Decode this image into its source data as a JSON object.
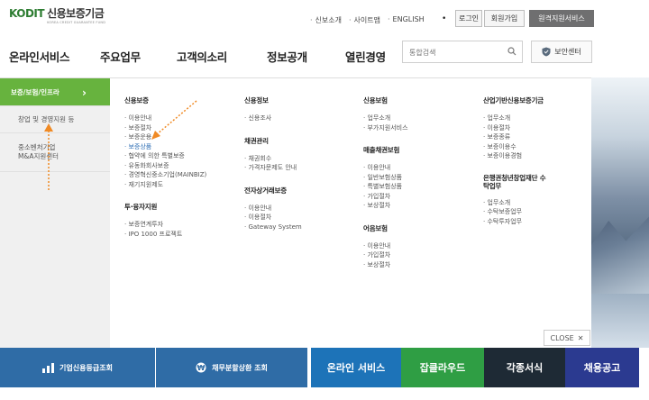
{
  "logo": {
    "mark": "KODIT",
    "title": "신용보증기금",
    "subtitle": "KOREA CREDIT GUARANTEE FUND"
  },
  "top_links": [
    "신보소개",
    "사이트맵",
    "ENGLISH"
  ],
  "top_buttons": {
    "login": "로그인",
    "join": "회원가입",
    "special": "원격지원서비스"
  },
  "gnb": [
    "온라인서비스",
    "주요업무",
    "고객의소리",
    "정보공개",
    "열린경영"
  ],
  "search": {
    "placeholder": "통합검색"
  },
  "security_center": "보안센터",
  "side_menu": {
    "active": "보증/보험/인프라",
    "items": [
      "창업 및 경영지원 등",
      "중소벤처기업 M&A지원센터"
    ]
  },
  "columns": [
    {
      "groups": [
        {
          "title": "신용보증",
          "items": [
            "이용안내",
            "보증절차",
            "보증운용",
            "보증상품",
            "협약에 의한 특별보증",
            "유동화회사보증",
            "경영혁신중소기업(MAINBIZ)",
            "재기지원제도"
          ],
          "highlight": 3
        },
        {
          "title": "투·융자지원",
          "items": [
            "보증연계투자",
            "IPO 1000 프로젝트"
          ]
        }
      ]
    },
    {
      "groups": [
        {
          "title": "신용정보",
          "items": [
            "신용조사"
          ]
        },
        {
          "title": "채권관리",
          "items": [
            "채권회수",
            "가격자문제도 안내"
          ]
        },
        {
          "title": "전자상거래보증",
          "items": [
            "이용안내",
            "이용절차",
            "Gateway System"
          ]
        }
      ]
    },
    {
      "groups": [
        {
          "title": "신용보험",
          "items": [
            "업무소개",
            "부가지원서비스"
          ]
        },
        {
          "title": "매출채권보험",
          "items": [
            "이용안내",
            "일반보험상품",
            "특별보험상품",
            "가입절차",
            "보상절차"
          ]
        },
        {
          "title": "어음보험",
          "items": [
            "이용안내",
            "가입절차",
            "보상절차"
          ]
        }
      ]
    },
    {
      "groups": [
        {
          "title": "산업기반신용보증기금",
          "items": [
            "업무소개",
            "이용절차",
            "보증종류",
            "보증이용수",
            "보증이용경험"
          ]
        },
        {
          "title": "은행권청년창업재단 수탁업무",
          "items": [
            "업무소개",
            "수탁보증업무",
            "수탁투자업무"
          ]
        }
      ]
    }
  ],
  "close_label": "CLOSE",
  "banners": [
    "기업신용등급조회",
    "채무분할상환 조회",
    "온라인 서비스",
    "잡클라우드",
    "각종서식",
    "채용공고"
  ],
  "colors": {
    "accent_green": "#67b33e",
    "link_blue": "#2f6fb5",
    "arrow_orange": "#f08a24"
  }
}
